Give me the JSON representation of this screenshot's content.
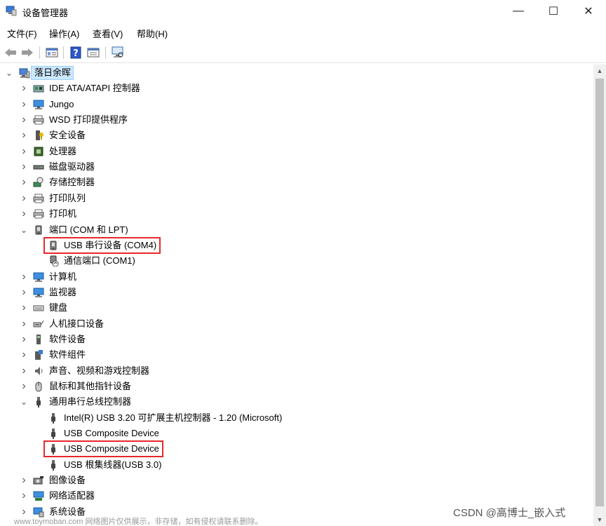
{
  "window": {
    "title": "设备管理器",
    "minimize_glyph": "—",
    "maximize_glyph": "☐",
    "close_glyph": "✕"
  },
  "menu": [
    {
      "label": "文件(F)"
    },
    {
      "label": "操作(A)"
    },
    {
      "label": "查看(V)"
    },
    {
      "label": "帮助(H)"
    }
  ],
  "toolbar": {
    "buttons": [
      "back-arrow-icon",
      "forward-arrow-icon",
      "properties-icon",
      "help-icon",
      "update-driver-icon",
      "monitor-scan-icon"
    ]
  },
  "tree": {
    "root": {
      "label": "落日余晖",
      "icon": "computer-icon",
      "expanded": true
    },
    "items": [
      {
        "label": "IDE ATA/ATAPI 控制器",
        "level": 1,
        "expanded": false,
        "icon": "ide-controller-icon"
      },
      {
        "label": "Jungo",
        "level": 1,
        "expanded": false,
        "icon": "monitor-icon"
      },
      {
        "label": "WSD 打印提供程序",
        "level": 1,
        "expanded": false,
        "icon": "printer-icon"
      },
      {
        "label": "安全设备",
        "level": 1,
        "expanded": false,
        "icon": "security-device-icon"
      },
      {
        "label": "处理器",
        "level": 1,
        "expanded": false,
        "icon": "processor-icon"
      },
      {
        "label": "磁盘驱动器",
        "level": 1,
        "expanded": false,
        "icon": "disk-drive-icon"
      },
      {
        "label": "存储控制器",
        "level": 1,
        "expanded": false,
        "icon": "storage-controller-icon"
      },
      {
        "label": "打印队列",
        "level": 1,
        "expanded": false,
        "icon": "printer-icon"
      },
      {
        "label": "打印机",
        "level": 1,
        "expanded": false,
        "icon": "printer-icon"
      },
      {
        "label": "端口 (COM 和 LPT)",
        "level": 1,
        "expanded": true,
        "icon": "port-icon"
      },
      {
        "label": "USB 串行设备 (COM4)",
        "level": 2,
        "icon": "port-icon",
        "highlighted": true
      },
      {
        "label": "通信端口 (COM1)",
        "level": 2,
        "icon": "comm-port-icon"
      },
      {
        "label": "计算机",
        "level": 1,
        "expanded": false,
        "icon": "monitor-icon"
      },
      {
        "label": "监视器",
        "level": 1,
        "expanded": false,
        "icon": "monitor-icon"
      },
      {
        "label": "键盘",
        "level": 1,
        "expanded": false,
        "icon": "keyboard-icon"
      },
      {
        "label": "人机接口设备",
        "level": 1,
        "expanded": false,
        "icon": "hid-icon"
      },
      {
        "label": "软件设备",
        "level": 1,
        "expanded": false,
        "icon": "software-device-icon"
      },
      {
        "label": "软件组件",
        "level": 1,
        "expanded": false,
        "icon": "software-component-icon"
      },
      {
        "label": "声音、视频和游戏控制器",
        "level": 1,
        "expanded": false,
        "icon": "speaker-icon"
      },
      {
        "label": "鼠标和其他指针设备",
        "level": 1,
        "expanded": false,
        "icon": "mouse-icon"
      },
      {
        "label": "通用串行总线控制器",
        "level": 1,
        "expanded": true,
        "icon": "usb-icon"
      },
      {
        "label": "Intel(R) USB 3.20 可扩展主机控制器 - 1.20 (Microsoft)",
        "level": 2,
        "icon": "usb-icon"
      },
      {
        "label": "USB Composite Device",
        "level": 2,
        "icon": "usb-icon"
      },
      {
        "label": "USB Composite Device",
        "level": 2,
        "icon": "usb-icon",
        "highlighted": true
      },
      {
        "label": "USB 根集线器(USB 3.0)",
        "level": 2,
        "icon": "usb-icon"
      },
      {
        "label": "图像设备",
        "level": 1,
        "expanded": false,
        "icon": "camera-icon"
      },
      {
        "label": "网络适配器",
        "level": 1,
        "expanded": false,
        "icon": "network-adapter-icon"
      },
      {
        "label": "系统设备",
        "level": 1,
        "expanded": false,
        "icon": "system-device-icon"
      }
    ]
  },
  "highlight_color": "#e8282c",
  "selection_color": "#cce8ff",
  "watermark": "CSDN @高博士_嵌入式",
  "watermark_small": "www.toymoban.com 网络图片仅供展示，非存储，如有侵权请联系删除。"
}
